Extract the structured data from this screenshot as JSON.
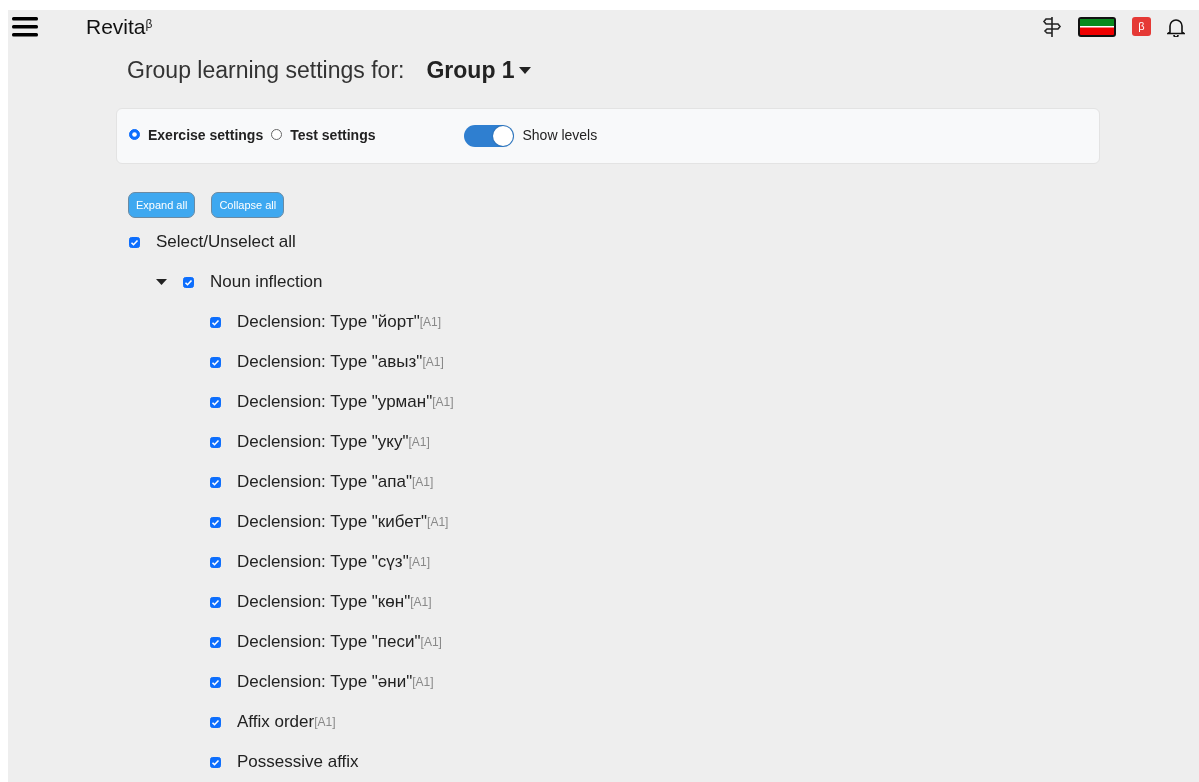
{
  "header": {
    "logo": "Revita",
    "logo_sup": "β",
    "badge": "β"
  },
  "title": {
    "label": "Group learning settings for:",
    "group": "Group 1"
  },
  "modes": [
    {
      "label": "Exercise settings",
      "selected": true
    },
    {
      "label": "Test settings",
      "selected": false
    }
  ],
  "show_levels": {
    "label": "Show levels",
    "on": true
  },
  "buttons": [
    "Expand all",
    "Collapse all"
  ],
  "tree": {
    "label": "Select/Unselect all",
    "checked": true,
    "children": [
      {
        "label": "Noun inflection",
        "checked": true,
        "expanded": true,
        "children": [
          {
            "label": "Declension: Type \"йорт\"",
            "tag": "[A1]",
            "checked": true
          },
          {
            "label": "Declension: Type \"авыз\"",
            "tag": "[A1]",
            "checked": true
          },
          {
            "label": "Declension: Type \"урман\"",
            "tag": "[A1]",
            "checked": true
          },
          {
            "label": "Declension: Type \"уку\"",
            "tag": "[A1]",
            "checked": true
          },
          {
            "label": "Declension: Type \"апа\"",
            "tag": "[A1]",
            "checked": true
          },
          {
            "label": "Declension: Type \"кибет\"",
            "tag": "[A1]",
            "checked": true
          },
          {
            "label": "Declension: Type \"сүз\"",
            "tag": "[A1]",
            "checked": true
          },
          {
            "label": "Declension: Type \"көн\"",
            "tag": "[A1]",
            "checked": true
          },
          {
            "label": "Declension: Type \"песи\"",
            "tag": "[A1]",
            "checked": true
          },
          {
            "label": "Declension: Type \"әни\"",
            "tag": "[A1]",
            "checked": true
          },
          {
            "label": "Affix order",
            "tag": "[A1]",
            "checked": true
          },
          {
            "label": "Possessive affix",
            "checked": true
          }
        ]
      }
    ]
  }
}
